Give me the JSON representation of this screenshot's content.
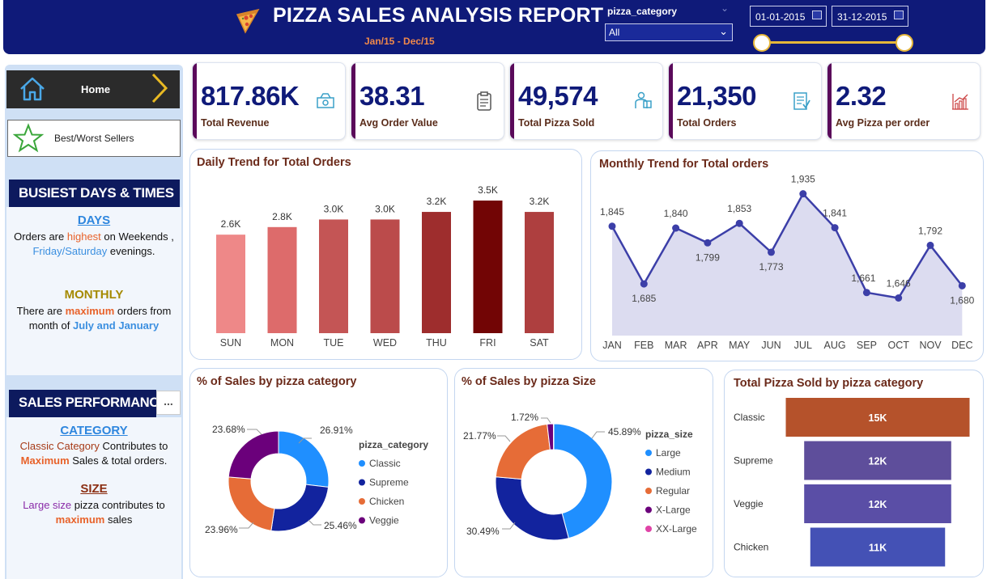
{
  "header": {
    "title": "PIZZA SALES ANALYSIS REPORT",
    "subtitle": "Jan/15 - Dec/15",
    "filter_label": "pizza_category",
    "filter_value": "All",
    "date_start": "01-01-2015",
    "date_end": "31-12-2015",
    "date_range_slider": {
      "start": 0.0,
      "end": 1.0
    },
    "colors": {
      "bar": "#0f1a79",
      "slider": "#e6b73a",
      "subtitle": "#f0884a"
    },
    "icons": [
      "pizza-slice-icon",
      "chevron-down-icon",
      "calendar-icon"
    ]
  },
  "sidebar": {
    "nav": [
      {
        "label": "Home",
        "icon": "home-icon"
      },
      {
        "label": "Best/Worst Sellers",
        "icon": "star-icon"
      }
    ],
    "busiest": {
      "heading": "BUSIEST DAYS & TIMES",
      "days_title": "DAYS",
      "days_t1": "Orders are ",
      "days_h1": "highest",
      "days_t2": " on Weekends , ",
      "days_h2": "Friday/Saturday",
      "days_t3": " evenings.",
      "monthly_title": "MONTHLY",
      "monthly_t1": "There are ",
      "monthly_h1": "maximum",
      "monthly_t2": " orders from month of ",
      "monthly_h2": "July and January"
    },
    "sales": {
      "heading": "SALES PERFORMANCE",
      "category_title": "CATEGORY",
      "cat_h1": "Classic Category",
      "cat_t1": " Contributes to ",
      "cat_h2": "Maximum",
      "cat_t2": " Sales & total orders.",
      "size_title": "SIZE",
      "size_h1": "Large size",
      "size_t1": " pizza contributes to ",
      "size_h2": "maximum",
      "size_t2": " sales",
      "more_label": "..."
    }
  },
  "kpis": [
    {
      "value": "817.86K",
      "label": "Total Revenue",
      "icon": "money-icon"
    },
    {
      "value": "38.31",
      "label": "Avg Order Value",
      "icon": "clipboard-icon"
    },
    {
      "value": "49,574",
      "label": "Total Pizza Sold",
      "icon": "delivery-icon"
    },
    {
      "value": "21,350",
      "label": "Total Orders",
      "icon": "checklist-icon"
    },
    {
      "value": "2.32",
      "label": "Avg Pizza per order",
      "icon": "growth-chart-icon"
    }
  ],
  "chart_data": [
    {
      "type": "bar",
      "title": "Daily Trend for Total Orders",
      "categories": [
        "SUN",
        "MON",
        "TUE",
        "WED",
        "THU",
        "FRI",
        "SAT"
      ],
      "values": [
        2.6,
        2.8,
        3.0,
        3.0,
        3.2,
        3.5,
        3.2
      ],
      "labels": [
        "2.6K",
        "2.8K",
        "3.0K",
        "3.0K",
        "3.2K",
        "3.5K",
        "3.2K"
      ],
      "colors": [
        "#ee8888",
        "#dd6b6b",
        "#c45555",
        "#bb4b4b",
        "#9e2d2d",
        "#720505",
        "#ae3f3f"
      ],
      "ylim": [
        0,
        3.5
      ],
      "grid": false
    },
    {
      "type": "area",
      "title": "Monthly Trend for Total orders",
      "categories": [
        "JAN",
        "FEB",
        "MAR",
        "APR",
        "MAY",
        "JUN",
        "JUL",
        "AUG",
        "SEP",
        "OCT",
        "NOV",
        "DEC"
      ],
      "values": [
        1845,
        1685,
        1840,
        1799,
        1853,
        1773,
        1935,
        1841,
        1661,
        1646,
        1792,
        1680
      ],
      "ylim": [
        1600,
        1950
      ],
      "line_color": "#3c3fa8",
      "fill_color": "#dcdcf0",
      "grid": false
    },
    {
      "type": "pie",
      "title": "% of Sales by pizza category",
      "legend_title": "pizza_category",
      "legend_placement": "right",
      "labels": [
        "Classic",
        "Supreme",
        "Chicken",
        "Veggie"
      ],
      "values": [
        26.91,
        25.46,
        23.96,
        23.68
      ],
      "value_labels": [
        "26.91%",
        "25.46%",
        "23.96%",
        "23.68%"
      ],
      "colors": [
        "#1f8fff",
        "#12239e",
        "#e66c37",
        "#6b007b"
      ]
    },
    {
      "type": "pie",
      "title": "% of Sales by pizza Size",
      "legend_title": "pizza_size",
      "legend_placement": "right",
      "labels": [
        "Large",
        "Medium",
        "Regular",
        "X-Large",
        "XX-Large"
      ],
      "values": [
        45.89,
        30.49,
        21.77,
        1.72,
        0.12
      ],
      "value_labels": [
        "45.89%",
        "30.49%",
        "21.77%",
        "1.72%",
        ""
      ],
      "colors": [
        "#1f8fff",
        "#12239e",
        "#e66c37",
        "#6b007b",
        "#e044a7"
      ]
    },
    {
      "type": "bar",
      "orientation": "horizontal",
      "title": "Total Pizza Sold by pizza category",
      "categories": [
        "Classic",
        "Supreme",
        "Veggie",
        "Chicken"
      ],
      "values": [
        15,
        12,
        12,
        11
      ],
      "labels": [
        "15K",
        "12K",
        "12K",
        "11K"
      ],
      "colors": [
        "#b5522b",
        "#5e4e9b",
        "#5a4ea6",
        "#4451b5"
      ]
    }
  ]
}
